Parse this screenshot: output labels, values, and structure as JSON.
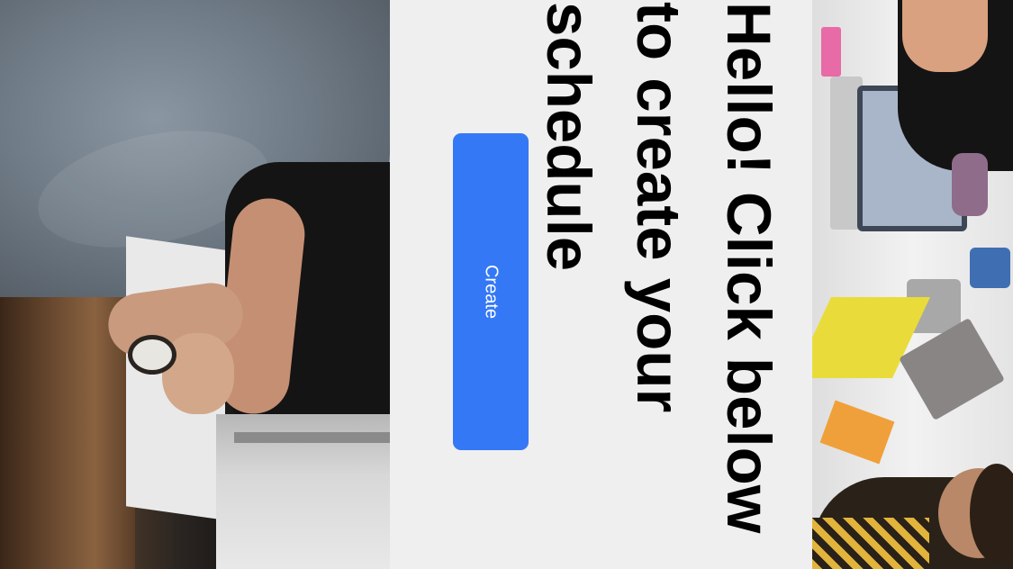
{
  "panel": {
    "greeting": "Hello! Click below to create your schedule",
    "button_label": "Create",
    "button_color": "#3478F6",
    "background_color": "#EFEFEF"
  },
  "images": {
    "left": "photo of a person typing at a wooden desk",
    "right": "overhead photo of an office table with laptops"
  }
}
